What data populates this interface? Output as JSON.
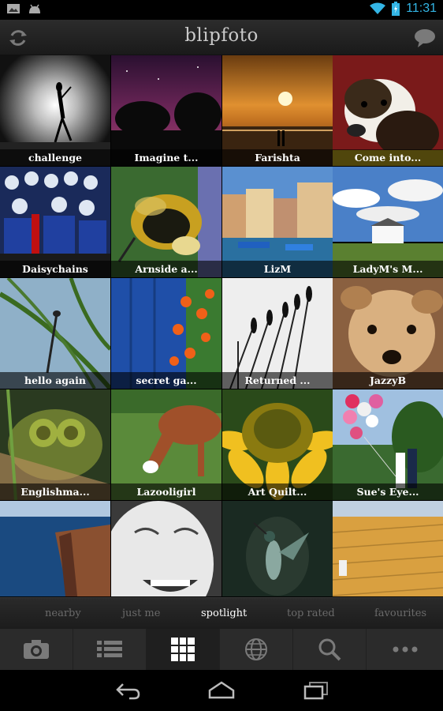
{
  "status": {
    "time": "11:31"
  },
  "app": {
    "title": "blipfoto"
  },
  "tiles": [
    {
      "caption": "challenge"
    },
    {
      "caption": "Imagine t..."
    },
    {
      "caption": "Farishta"
    },
    {
      "caption": "Come into..."
    },
    {
      "caption": "Daisychains"
    },
    {
      "caption": "Arnside a..."
    },
    {
      "caption": "LizM"
    },
    {
      "caption": "LadyM's M..."
    },
    {
      "caption": "hello again"
    },
    {
      "caption": "secret ga..."
    },
    {
      "caption": "Returned ..."
    },
    {
      "caption": "JazzyB"
    },
    {
      "caption": "Englishma..."
    },
    {
      "caption": "Lazooligirl"
    },
    {
      "caption": "Art Quilt..."
    },
    {
      "caption": "Sue's Eye..."
    },
    {
      "caption": ""
    },
    {
      "caption": ""
    },
    {
      "caption": ""
    },
    {
      "caption": ""
    }
  ],
  "filters": {
    "nearby": "nearby",
    "just_me": "just me",
    "spotlight": "spotlight",
    "top_rated": "top rated",
    "favourites": "favourites",
    "active": "spotlight"
  },
  "toolbar": {
    "icons": [
      "camera-icon",
      "list-icon",
      "grid-icon",
      "globe-icon",
      "search-icon",
      "more-icon"
    ],
    "active": "grid-icon"
  },
  "colors": {
    "accent": "#33b5e5",
    "active_filter": "#ffffff",
    "inactive_filter": "#6a6a6a"
  }
}
